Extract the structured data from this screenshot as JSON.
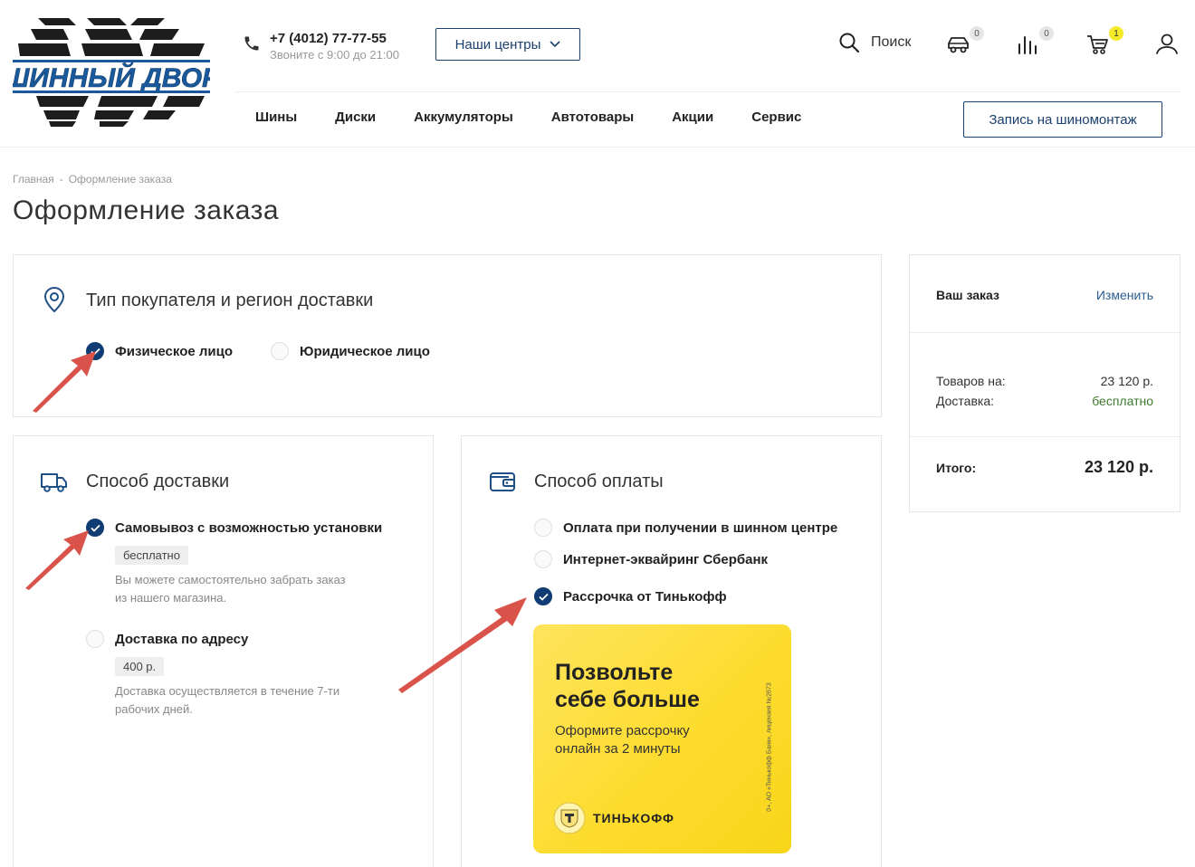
{
  "header": {
    "logo_text": "ШИННЫЙ ДВОР",
    "phone": "+7 (4012) 77-77-55",
    "hours": "Звоните с 9:00 до 21:00",
    "centers_label": "Наши центры",
    "search_label": "Поиск",
    "garage_count": "0",
    "compare_count": "0",
    "cart_count": "1",
    "booking_label": "Запись на шиномонтаж"
  },
  "nav": [
    "Шины",
    "Диски",
    "Аккумуляторы",
    "Автотовары",
    "Акции",
    "Сервис"
  ],
  "breadcrumb": {
    "home": "Главная",
    "separator": "-",
    "current": "Оформление заказа"
  },
  "page_title": "Оформление заказа",
  "buyer_type": {
    "title": "Тип покупателя и регион доставки",
    "options": [
      {
        "label": "Физическое лицо",
        "checked": true
      },
      {
        "label": "Юридическое лицо",
        "checked": false
      }
    ]
  },
  "delivery": {
    "title": "Способ доставки",
    "options": [
      {
        "label": "Самовывоз с возможностью установки",
        "checked": true,
        "price": "бесплатно",
        "desc": "Вы можете самостоятельно забрать заказ из нашего магазина."
      },
      {
        "label": "Доставка по адресу",
        "checked": false,
        "price": "400 р.",
        "desc": "Доставка осуществляется в течение 7-ти рабочих дней."
      }
    ]
  },
  "payment": {
    "title": "Способ оплаты",
    "options": [
      {
        "label": "Оплата при получении в шинном центре",
        "checked": false
      },
      {
        "label": "Интернет-эквайринг Сбербанк",
        "checked": false
      },
      {
        "label": "Рассрочка от Тинькофф",
        "checked": true
      }
    ],
    "banner": {
      "headline_1": "Позвольте",
      "headline_2": "себе больше",
      "sub_1": "Оформите рассрочку",
      "sub_2": "онлайн за 2 минуты",
      "brand": "ТИНЬКОФФ",
      "legal": "0+, АО «Тинькофф Банк», лицензия №2673"
    }
  },
  "order": {
    "title": "Ваш заказ",
    "change_label": "Изменить",
    "goods_label": "Товаров на:",
    "goods_value": "23 120 р.",
    "delivery_label": "Доставка:",
    "delivery_value": "бесплатно",
    "total_label": "Итого:",
    "total_value": "23 120 р."
  },
  "colors": {
    "brand": "#0f3d73",
    "accent_yellow": "#f5ea2a",
    "free_green": "#3d7a2e",
    "arrow_red": "#d9534a"
  }
}
